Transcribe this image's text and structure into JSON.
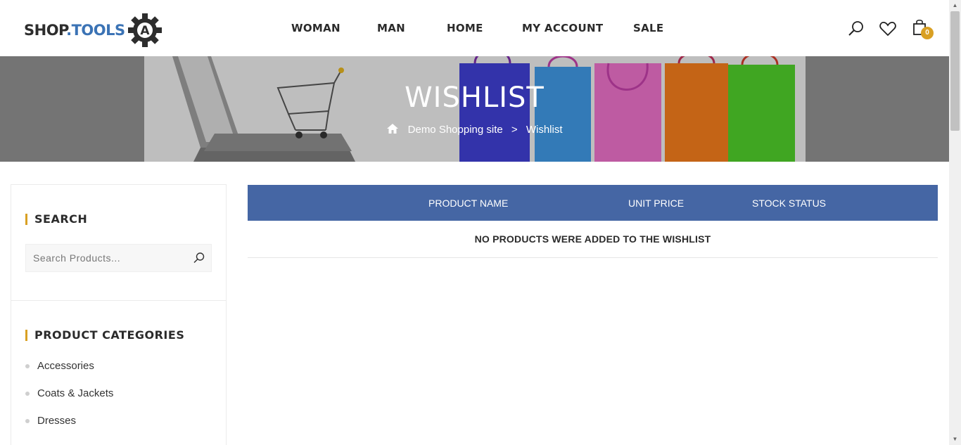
{
  "logo": {
    "part1": "SHOP",
    "part2": ".TOOLS",
    "mark": "A"
  },
  "nav": {
    "items": [
      "WOMAN",
      "MAN",
      "HOME",
      "MY ACCOUNT",
      "SALE"
    ]
  },
  "header_icons": {
    "search": "search-icon",
    "wishlist": "heart-icon",
    "cart": "cart-bag-icon",
    "cart_count": "0"
  },
  "banner": {
    "title": "WISHLIST",
    "breadcrumb": {
      "home": "Demo Shopping site",
      "separator": ">",
      "current": "Wishlist"
    }
  },
  "sidebar": {
    "search": {
      "title": "SEARCH",
      "placeholder": "Search Products..."
    },
    "categories": {
      "title": "PRODUCT CATEGORIES",
      "items": [
        "Accessories",
        "Coats & Jackets",
        "Dresses"
      ]
    }
  },
  "wishlist_table": {
    "headers": [
      "PRODUCT NAME",
      "UNIT PRICE",
      "STOCK STATUS"
    ],
    "empty_message": "NO PRODUCTS WERE ADDED TO THE WISHLIST"
  },
  "colors": {
    "accent": "#d9a023",
    "table_header": "#4566a4",
    "logo_blue": "#3b73b5"
  }
}
